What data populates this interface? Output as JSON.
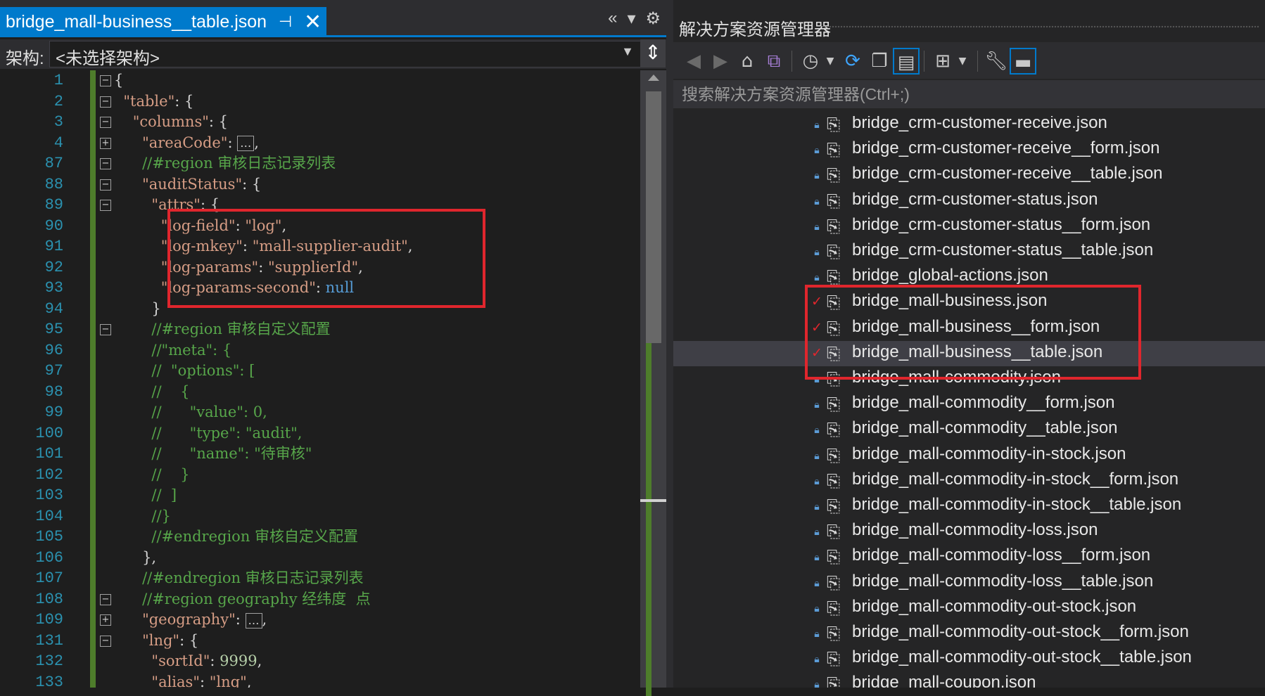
{
  "editor": {
    "tab_title": "bridge_mall-business__table.json",
    "tab_pin": "⊣",
    "tab_close": "✕",
    "tabbar_icons": [
      "«",
      "▾",
      "⚙"
    ],
    "schema_label": "架构:",
    "schema_value": "<未选择架构>",
    "line_numbers": [
      "1",
      "2",
      "3",
      "4",
      "87",
      "88",
      "89",
      "90",
      "91",
      "92",
      "93",
      "94",
      "95",
      "96",
      "97",
      "98",
      "99",
      "100",
      "101",
      "102",
      "103",
      "104",
      "105",
      "106",
      "107",
      "108",
      "109",
      "131",
      "132",
      "133"
    ]
  },
  "code_lines": [
    {
      "fold": "minus",
      "indent": "",
      "parts": [
        {
          "t": "{",
          "c": "p"
        }
      ]
    },
    {
      "fold": "minus",
      "indent": "  ",
      "parts": [
        {
          "t": "\"table\"",
          "c": "k"
        },
        {
          "t": ": {",
          "c": "p"
        }
      ]
    },
    {
      "fold": "minus",
      "indent": "    ",
      "parts": [
        {
          "t": "\"columns\"",
          "c": "k"
        },
        {
          "t": ": {",
          "c": "p"
        }
      ]
    },
    {
      "fold": "plus",
      "indent": "      ",
      "parts": [
        {
          "t": "\"areaCode\"",
          "c": "k"
        },
        {
          "t": ": ",
          "c": "p"
        },
        {
          "t": "…",
          "c": "dots"
        },
        {
          "t": ",",
          "c": "p"
        }
      ]
    },
    {
      "fold": "minus",
      "indent": "      ",
      "parts": [
        {
          "t": "//#region 审核日志记录列表",
          "c": "c"
        }
      ]
    },
    {
      "fold": "minus",
      "indent": "      ",
      "parts": [
        {
          "t": "\"auditStatus\"",
          "c": "k"
        },
        {
          "t": ": {",
          "c": "p"
        }
      ]
    },
    {
      "fold": "minus",
      "indent": "        ",
      "parts": [
        {
          "t": "\"attrs\"",
          "c": "k"
        },
        {
          "t": ": {",
          "c": "p"
        }
      ]
    },
    {
      "fold": "",
      "indent": "          ",
      "parts": [
        {
          "t": "\"log-field\"",
          "c": "k"
        },
        {
          "t": ": ",
          "c": "p"
        },
        {
          "t": "\"log\"",
          "c": "s"
        },
        {
          "t": ",",
          "c": "p"
        }
      ]
    },
    {
      "fold": "",
      "indent": "          ",
      "parts": [
        {
          "t": "\"log-mkey\"",
          "c": "k"
        },
        {
          "t": ": ",
          "c": "p"
        },
        {
          "t": "\"mall-supplier-audit\"",
          "c": "s"
        },
        {
          "t": ",",
          "c": "p"
        }
      ]
    },
    {
      "fold": "",
      "indent": "          ",
      "parts": [
        {
          "t": "\"log-params\"",
          "c": "k"
        },
        {
          "t": ": ",
          "c": "p"
        },
        {
          "t": "\"supplierId\"",
          "c": "s"
        },
        {
          "t": ",",
          "c": "p"
        }
      ]
    },
    {
      "fold": "",
      "indent": "          ",
      "parts": [
        {
          "t": "\"log-params-second\"",
          "c": "k"
        },
        {
          "t": ": ",
          "c": "p"
        },
        {
          "t": "null",
          "c": "nl"
        }
      ]
    },
    {
      "fold": "",
      "indent": "        ",
      "parts": [
        {
          "t": "}",
          "c": "p"
        }
      ]
    },
    {
      "fold": "minus",
      "indent": "        ",
      "parts": [
        {
          "t": "//#region 审核自定义配置",
          "c": "c"
        }
      ]
    },
    {
      "fold": "",
      "indent": "        ",
      "parts": [
        {
          "t": "//\"meta\": {",
          "c": "c"
        }
      ]
    },
    {
      "fold": "",
      "indent": "        ",
      "parts": [
        {
          "t": "//  \"options\": [",
          "c": "c"
        }
      ]
    },
    {
      "fold": "",
      "indent": "        ",
      "parts": [
        {
          "t": "//    {",
          "c": "c"
        }
      ]
    },
    {
      "fold": "",
      "indent": "        ",
      "parts": [
        {
          "t": "//      \"value\": 0,",
          "c": "c"
        }
      ]
    },
    {
      "fold": "",
      "indent": "        ",
      "parts": [
        {
          "t": "//      \"type\": \"audit\",",
          "c": "c"
        }
      ]
    },
    {
      "fold": "",
      "indent": "        ",
      "parts": [
        {
          "t": "//      \"name\": \"待审核\"",
          "c": "c"
        }
      ]
    },
    {
      "fold": "",
      "indent": "        ",
      "parts": [
        {
          "t": "//    }",
          "c": "c"
        }
      ]
    },
    {
      "fold": "",
      "indent": "        ",
      "parts": [
        {
          "t": "//  ]",
          "c": "c"
        }
      ]
    },
    {
      "fold": "",
      "indent": "        ",
      "parts": [
        {
          "t": "//}",
          "c": "c"
        }
      ]
    },
    {
      "fold": "",
      "indent": "        ",
      "parts": [
        {
          "t": "//#endregion 审核自定义配置",
          "c": "c"
        }
      ]
    },
    {
      "fold": "",
      "indent": "      ",
      "parts": [
        {
          "t": "},",
          "c": "p"
        }
      ]
    },
    {
      "fold": "",
      "indent": "      ",
      "parts": [
        {
          "t": "//#endregion 审核日志记录列表",
          "c": "c"
        }
      ]
    },
    {
      "fold": "minus",
      "indent": "      ",
      "parts": [
        {
          "t": "//#region geography 经纬度  点",
          "c": "c"
        }
      ]
    },
    {
      "fold": "plus",
      "indent": "      ",
      "parts": [
        {
          "t": "\"geography\"",
          "c": "k"
        },
        {
          "t": ": ",
          "c": "p"
        },
        {
          "t": "…",
          "c": "dots"
        },
        {
          "t": ",",
          "c": "p"
        }
      ]
    },
    {
      "fold": "minus",
      "indent": "      ",
      "parts": [
        {
          "t": "\"lng\"",
          "c": "k"
        },
        {
          "t": ": {",
          "c": "p"
        }
      ]
    },
    {
      "fold": "",
      "indent": "        ",
      "parts": [
        {
          "t": "\"sortId\"",
          "c": "k"
        },
        {
          "t": ": ",
          "c": "p"
        },
        {
          "t": "9999",
          "c": "n"
        },
        {
          "t": ",",
          "c": "p"
        }
      ]
    },
    {
      "fold": "",
      "indent": "        ",
      "parts": [
        {
          "t": "\"alias\"",
          "c": "k"
        },
        {
          "t": ": ",
          "c": "p"
        },
        {
          "t": "\"lng\"",
          "c": "s"
        },
        {
          "t": ",",
          "c": "p"
        }
      ]
    }
  ],
  "explorer": {
    "title": "解决方案资源管理器",
    "search_placeholder": "搜索解决方案资源管理器(Ctrl+;)",
    "toolbar_icons": [
      "back-icon",
      "forward-icon",
      "home-icon",
      "vs-sync-icon",
      "history-icon",
      "dropdown-icon",
      "refresh-icon",
      "collapse-all-icon",
      "show-all-files-icon",
      "properties-icon",
      "dropdown-icon",
      "settings-wrench-icon",
      "pin-icon"
    ],
    "files": [
      {
        "name": "bridge_crm-customer-receive.json",
        "status": "lock",
        "selected": false
      },
      {
        "name": "bridge_crm-customer-receive__form.json",
        "status": "lock",
        "selected": false
      },
      {
        "name": "bridge_crm-customer-receive__table.json",
        "status": "lock",
        "selected": false
      },
      {
        "name": "bridge_crm-customer-status.json",
        "status": "lock",
        "selected": false
      },
      {
        "name": "bridge_crm-customer-status__form.json",
        "status": "lock",
        "selected": false
      },
      {
        "name": "bridge_crm-customer-status__table.json",
        "status": "lock",
        "selected": false
      },
      {
        "name": "bridge_global-actions.json",
        "status": "lock",
        "selected": false
      },
      {
        "name": "bridge_mall-business.json",
        "status": "check",
        "selected": false
      },
      {
        "name": "bridge_mall-business__form.json",
        "status": "check",
        "selected": false
      },
      {
        "name": "bridge_mall-business__table.json",
        "status": "check",
        "selected": true
      },
      {
        "name": "bridge_mall-commodity.json",
        "status": "lock",
        "selected": false
      },
      {
        "name": "bridge_mall-commodity__form.json",
        "status": "lock",
        "selected": false
      },
      {
        "name": "bridge_mall-commodity__table.json",
        "status": "lock",
        "selected": false
      },
      {
        "name": "bridge_mall-commodity-in-stock.json",
        "status": "lock",
        "selected": false
      },
      {
        "name": "bridge_mall-commodity-in-stock__form.json",
        "status": "lock",
        "selected": false
      },
      {
        "name": "bridge_mall-commodity-in-stock__table.json",
        "status": "lock",
        "selected": false
      },
      {
        "name": "bridge_mall-commodity-loss.json",
        "status": "lock",
        "selected": false
      },
      {
        "name": "bridge_mall-commodity-loss__form.json",
        "status": "lock",
        "selected": false
      },
      {
        "name": "bridge_mall-commodity-loss__table.json",
        "status": "lock",
        "selected": false
      },
      {
        "name": "bridge_mall-commodity-out-stock.json",
        "status": "lock",
        "selected": false
      },
      {
        "name": "bridge_mall-commodity-out-stock__form.json",
        "status": "lock",
        "selected": false
      },
      {
        "name": "bridge_mall-commodity-out-stock__table.json",
        "status": "lock",
        "selected": false
      },
      {
        "name": "bridge_mall-coupon.json",
        "status": "lock",
        "selected": false
      }
    ]
  },
  "colors": {
    "accent": "#007acc",
    "highlight_box": "#e0262d",
    "json_key": "#d69d85",
    "comment": "#57a64a",
    "line_number": "#2b91af"
  }
}
